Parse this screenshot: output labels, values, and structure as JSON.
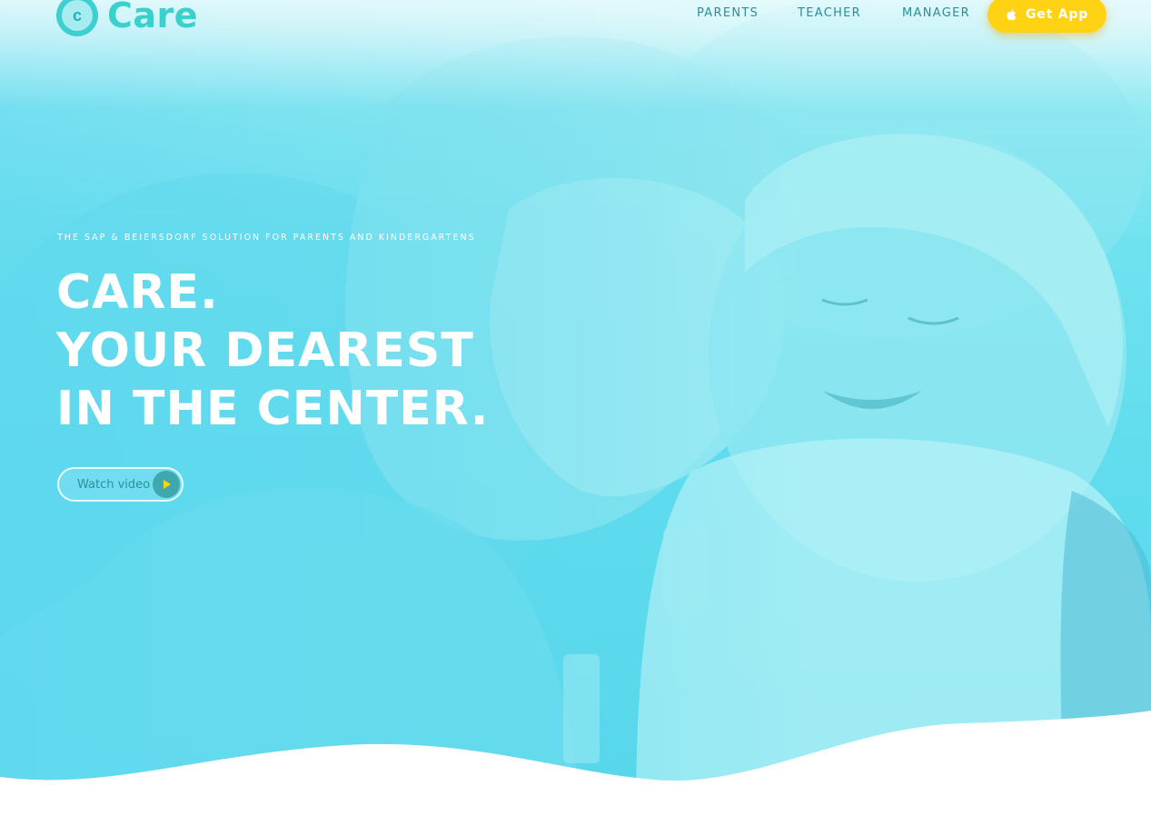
{
  "brand": {
    "name": "Care",
    "mark_letter": "c"
  },
  "nav": {
    "links": [
      "PARENTS",
      "TEACHER",
      "MANAGER"
    ],
    "cta_label": "Get App"
  },
  "hero": {
    "kicker": "THE SAP & BEIERSDORF SOLUTION FOR PARENTS AND KINDERGARTENS",
    "headline": [
      "CARE.",
      "YOUR DEAREST",
      "IN THE CENTER."
    ],
    "watch_label": "Watch video"
  },
  "colors": {
    "accent_yellow": "#ffd313",
    "teal_text": "#2a8e98",
    "hero_cyan": "#5fdcee",
    "logo_teal": "#3ad0cc"
  },
  "icons": [
    "apple-icon",
    "play-icon"
  ]
}
